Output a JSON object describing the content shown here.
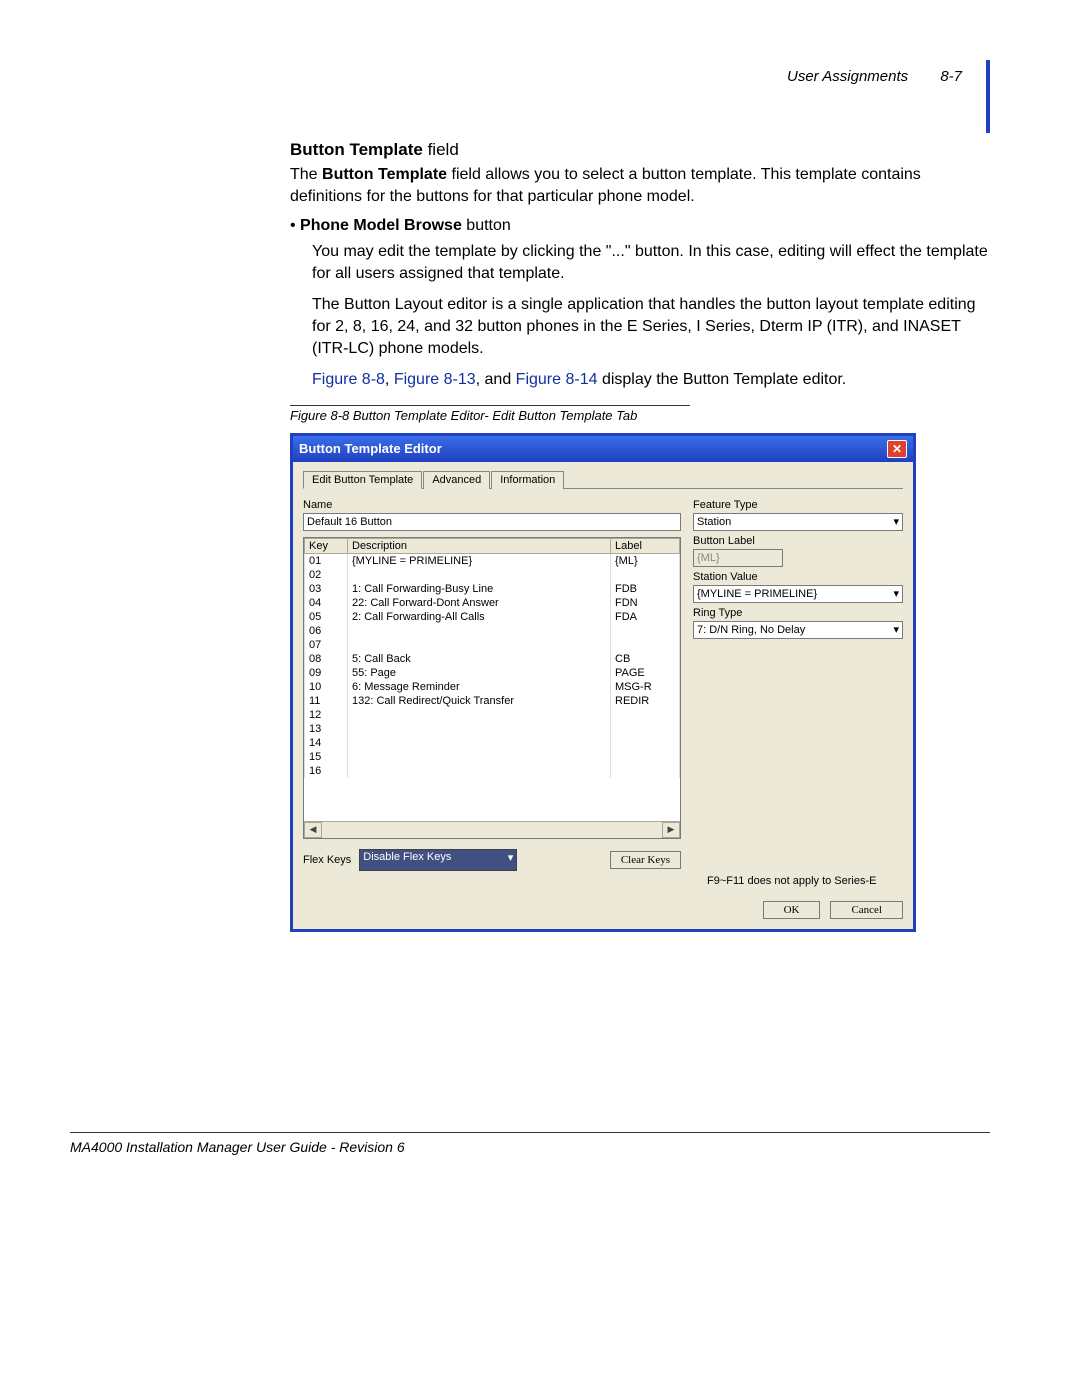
{
  "header": {
    "section": "User Assignments",
    "page": "8-7"
  },
  "section_title_prefix": "Button Template",
  "section_title_suffix": " field",
  "para1_a": "The ",
  "para1_b": "Button Template",
  "para1_c": " field allows you to select a button template. This template contains definitions for the buttons for that particular phone model.",
  "bullet_prefix": "• ",
  "bullet_bold": "Phone Model Browse",
  "bullet_suffix": " button",
  "para2": "You may edit the template by clicking the \"...\" button. In this case, editing will effect the template for all users assigned that template.",
  "para3": "The Button Layout editor is a single application that handles the button layout template editing for 2, 8, 16, 24, and 32 button phones in the E Series, I Series, Dterm IP (ITR), and INASET (ITR-LC) phone models.",
  "para4_refs": [
    "Figure 8-8",
    "Figure 8-13",
    "Figure 8-14"
  ],
  "para4_mid1": ", ",
  "para4_mid2": ", and ",
  "para4_tail": " display the Button Template editor.",
  "fig_caption": "Figure 8-8  Button Template Editor- Edit Button Template Tab",
  "dialog": {
    "title": "Button Template Editor",
    "tabs": [
      "Edit Button Template",
      "Advanced",
      "Information"
    ],
    "name_label": "Name",
    "name_value": "Default 16 Button",
    "table_headers": [
      "Key",
      "Description",
      "Label"
    ],
    "rows": [
      {
        "key": "01",
        "desc": "{MYLINE = PRIMELINE}",
        "label": "{ML}"
      },
      {
        "key": "02",
        "desc": "",
        "label": ""
      },
      {
        "key": "03",
        "desc": "1: Call Forwarding-Busy Line",
        "label": "FDB"
      },
      {
        "key": "04",
        "desc": "22: Call Forward-Dont Answer",
        "label": "FDN"
      },
      {
        "key": "05",
        "desc": "2: Call Forwarding-All Calls",
        "label": "FDA"
      },
      {
        "key": "06",
        "desc": "",
        "label": ""
      },
      {
        "key": "07",
        "desc": "",
        "label": ""
      },
      {
        "key": "08",
        "desc": "5: Call Back",
        "label": "CB"
      },
      {
        "key": "09",
        "desc": "55: Page",
        "label": "PAGE"
      },
      {
        "key": "10",
        "desc": "6: Message Reminder",
        "label": "MSG-R"
      },
      {
        "key": "11",
        "desc": "132: Call Redirect/Quick Transfer",
        "label": "REDIR"
      },
      {
        "key": "12",
        "desc": "",
        "label": ""
      },
      {
        "key": "13",
        "desc": "",
        "label": ""
      },
      {
        "key": "14",
        "desc": "",
        "label": ""
      },
      {
        "key": "15",
        "desc": "",
        "label": ""
      },
      {
        "key": "16",
        "desc": "",
        "label": ""
      }
    ],
    "feature_type_label": "Feature Type",
    "feature_type_value": "Station",
    "button_label_label": "Button Label",
    "button_label_value": "{ML}",
    "station_value_label": "Station Value",
    "station_value_value": "{MYLINE = PRIMELINE}",
    "ring_type_label": "Ring Type",
    "ring_type_value": "7: D/N Ring, No Delay",
    "flex_label": "Flex Keys",
    "flex_value": "Disable Flex Keys",
    "clear_btn": "Clear Keys",
    "note": "F9~F11 does not apply to Series-E",
    "ok": "OK",
    "cancel": "Cancel"
  },
  "footer": "MA4000 Installation Manager User Guide - Revision 6"
}
